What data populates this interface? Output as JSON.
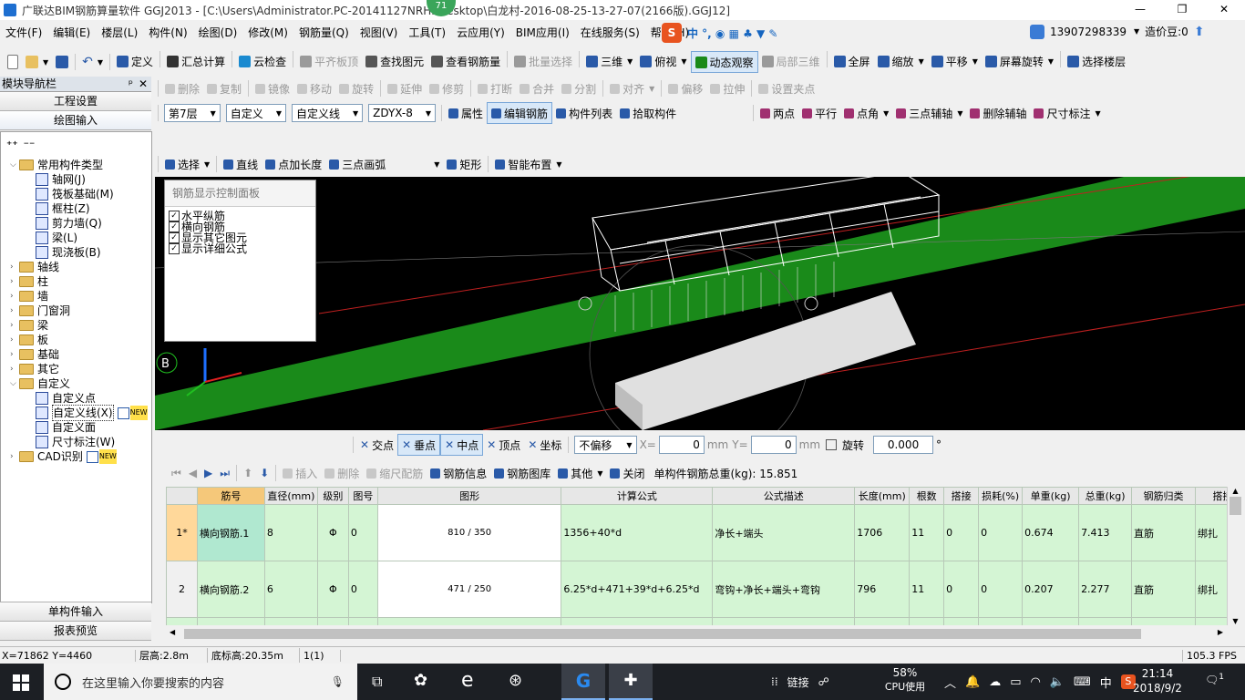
{
  "window": {
    "title": "广联达BIM钢筋算量软件 GGJ2013 - [C:\\Users\\Administrator.PC-20141127NRHI\\Desktop\\白龙村-2016-08-25-13-27-07(2166版).GGJ12]",
    "badge": "71"
  },
  "menu": [
    "文件(F)",
    "编辑(E)",
    "楼层(L)",
    "构件(N)",
    "绘图(D)",
    "修改(M)",
    "钢筋量(Q)",
    "视图(V)",
    "工具(T)",
    "云应用(Y)",
    "BIM应用(I)",
    "在线服务(S)",
    "帮助(H)"
  ],
  "account": {
    "phone": "13907298339",
    "price": "造价豆:0"
  },
  "toolbar1": [
    "定义",
    "汇总计算",
    "云检查",
    "平齐板顶",
    "查找图元",
    "查看钢筋量",
    "批量选择",
    "三维",
    "俯视",
    "动态观察",
    "局部三维",
    "全屏",
    "缩放",
    "平移",
    "屏幕旋转",
    "选择楼层"
  ],
  "nav": {
    "title": "模块导航栏",
    "tab1": "工程设置",
    "tab2": "绘图输入",
    "tree": [
      {
        "label": "常用构件类型",
        "level": 0,
        "folder": true,
        "open": true
      },
      {
        "label": "轴网(J)",
        "level": 1
      },
      {
        "label": "筏板基础(M)",
        "level": 1
      },
      {
        "label": "框柱(Z)",
        "level": 1
      },
      {
        "label": "剪力墙(Q)",
        "level": 1
      },
      {
        "label": "梁(L)",
        "level": 1
      },
      {
        "label": "现浇板(B)",
        "level": 1
      },
      {
        "label": "轴线",
        "level": 0,
        "folder": true
      },
      {
        "label": "柱",
        "level": 0,
        "folder": true
      },
      {
        "label": "墙",
        "level": 0,
        "folder": true
      },
      {
        "label": "门窗洞",
        "level": 0,
        "folder": true
      },
      {
        "label": "梁",
        "level": 0,
        "folder": true
      },
      {
        "label": "板",
        "level": 0,
        "folder": true
      },
      {
        "label": "基础",
        "level": 0,
        "folder": true
      },
      {
        "label": "其它",
        "level": 0,
        "folder": true
      },
      {
        "label": "自定义",
        "level": 0,
        "folder": true,
        "open": true
      },
      {
        "label": "自定义点",
        "level": 1
      },
      {
        "label": "自定义线(X)",
        "level": 1,
        "tag": "NEW"
      },
      {
        "label": "自定义面",
        "level": 1
      },
      {
        "label": "尺寸标注(W)",
        "level": 1
      },
      {
        "label": "CAD识别",
        "level": 0,
        "folder": true,
        "tag": "NEW"
      }
    ],
    "bottom1": "单构件输入",
    "bottom2": "报表预览"
  },
  "toolbar2": [
    "删除",
    "复制",
    "镜像",
    "移动",
    "旋转",
    "延伸",
    "修剪",
    "打断",
    "合并",
    "分割",
    "对齐",
    "偏移",
    "拉伸",
    "设置夹点"
  ],
  "toolbar3": {
    "floor": "第7层",
    "type": "自定义",
    "subtype": "自定义线",
    "name": "ZDYX-8",
    "items": [
      "属性",
      "编辑钢筋",
      "构件列表",
      "拾取构件",
      "两点",
      "平行",
      "点角",
      "三点辅轴",
      "删除辅轴",
      "尺寸标注"
    ]
  },
  "toolbar4": [
    "选择",
    "直线",
    "点加长度",
    "三点画弧",
    "矩形",
    "智能布置"
  ],
  "panel": {
    "title": "钢筋显示控制面板",
    "items": [
      "水平纵筋",
      "横向钢筋",
      "显示其它图元",
      "显示详细公式"
    ]
  },
  "viewport": {
    "axis_label": "B"
  },
  "snapbar": {
    "items": [
      "交点",
      "垂点",
      "中点",
      "顶点",
      "坐标"
    ],
    "offset": "不偏移",
    "x_label": "X=",
    "x": "0",
    "unit": "mm",
    "y_label": "Y=",
    "y": "0",
    "rotate": "旋转",
    "angle": "0.000",
    "deg": "°"
  },
  "rebar_toolbar": {
    "items": [
      "插入",
      "删除",
      "缩尺配筋",
      "钢筋信息",
      "钢筋图库",
      "其他",
      "关闭"
    ],
    "total": "单构件钢筋总重(kg): 15.851"
  },
  "table": {
    "headers": [
      "",
      "筋号",
      "直径(mm)",
      "级别",
      "图号",
      "图形",
      "计算公式",
      "公式描述",
      "长度(mm)",
      "根数",
      "搭接",
      "损耗(%)",
      "单重(kg)",
      "总重(kg)",
      "钢筋归类",
      "搭接"
    ],
    "rows": [
      {
        "no": "1*",
        "name": "横向钢筋.1",
        "dia": "8",
        "grade": "Φ",
        "fig": "0",
        "shape": "810 / 350",
        "formula": "1356+40*d",
        "desc": "净长+端头",
        "len": "1706",
        "count": "11",
        "lap": "0",
        "loss": "0",
        "unit": "0.674",
        "total": "7.413",
        "cat": "直筋",
        "lapt": "绑扎"
      },
      {
        "no": "2",
        "name": "横向钢筋.2",
        "dia": "6",
        "grade": "Φ",
        "fig": "0",
        "shape": "471 / 250",
        "formula": "6.25*d+471+39*d+6.25*d",
        "desc": "弯钩+净长+端头+弯钩",
        "len": "796",
        "count": "11",
        "lap": "0",
        "loss": "0",
        "unit": "0.207",
        "total": "2.277",
        "cat": "直筋",
        "lapt": "绑扎"
      }
    ]
  },
  "status": {
    "coord": "X=71862 Y=4460",
    "floor_h": "层高:2.8m",
    "bottom_h": "底标高:20.35m",
    "sel": "1(1)",
    "fps": "105.3 FPS"
  },
  "taskbar": {
    "search": "在这里输入你要搜索的内容",
    "link": "链接",
    "cpu": "58%",
    "cpu_label": "CPU使用",
    "ime": "中",
    "time": "21:14",
    "date": "2018/9/2",
    "notif": "1"
  }
}
